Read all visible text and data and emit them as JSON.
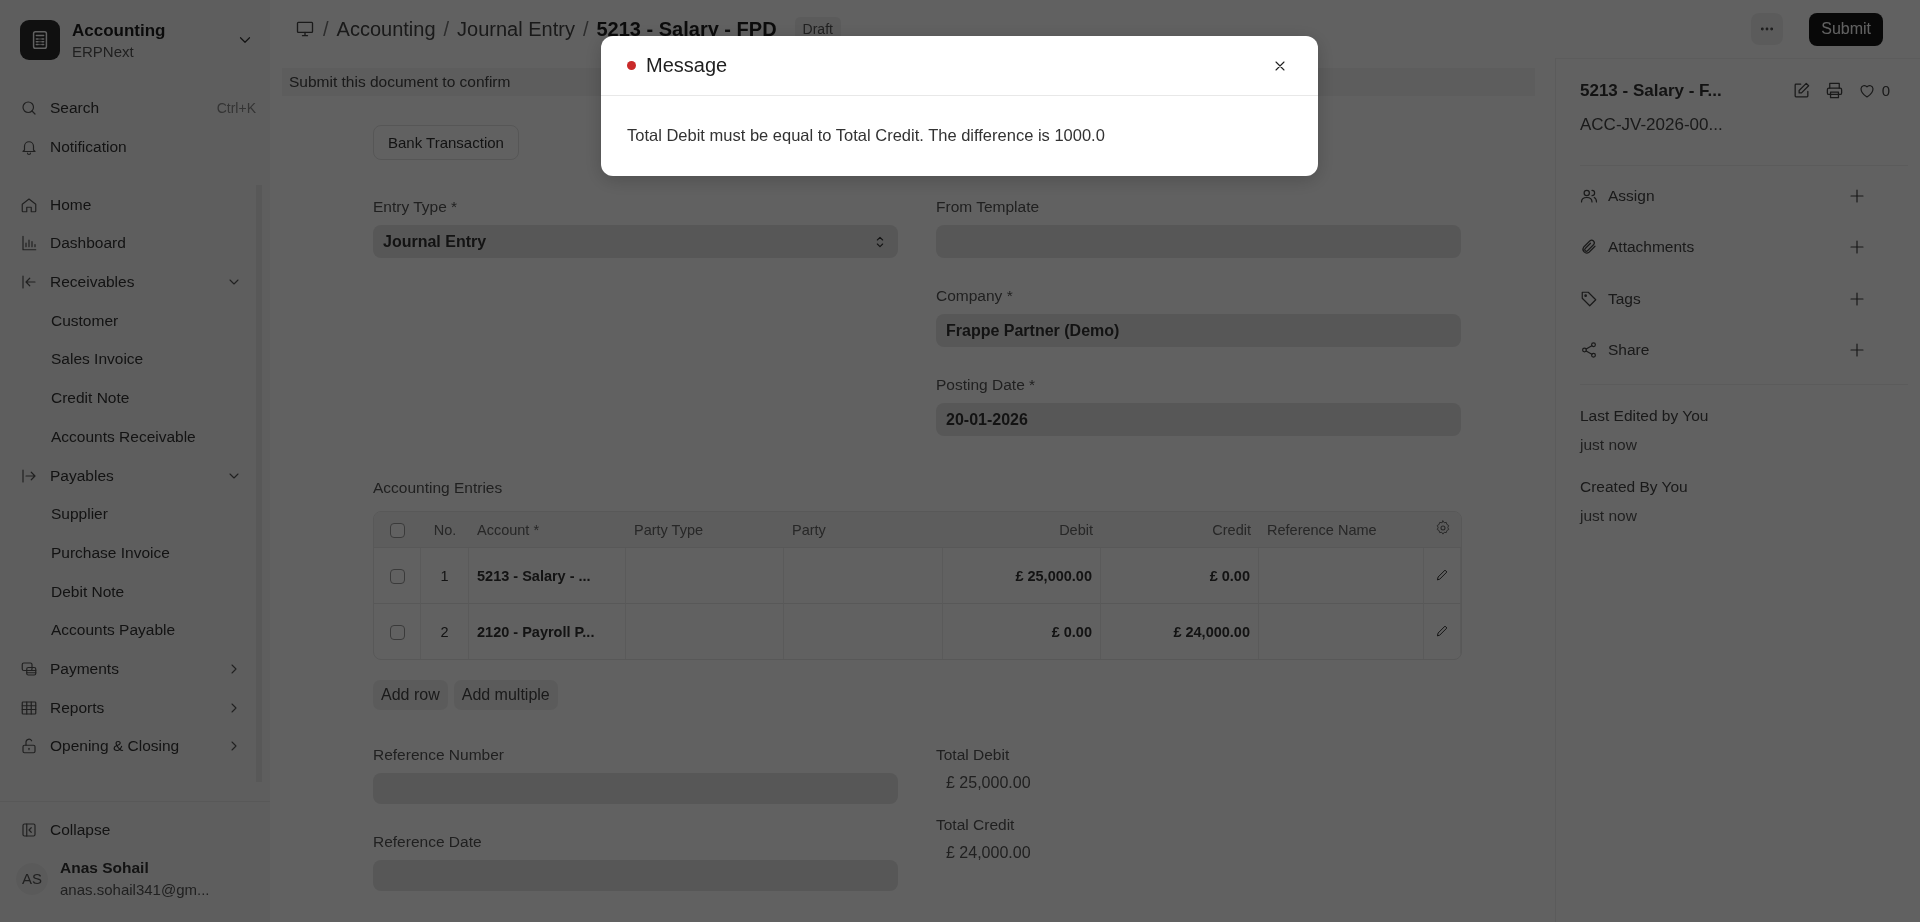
{
  "app": {
    "title": "Accounting",
    "subtitle": "ERPNext"
  },
  "sidebar": {
    "search": {
      "label": "Search",
      "shortcut": "Ctrl+K"
    },
    "notification": "Notification",
    "items": [
      {
        "kind": "link",
        "label": "Home"
      },
      {
        "kind": "link",
        "label": "Dashboard"
      },
      {
        "kind": "group",
        "label": "Receivables",
        "expanded": true,
        "children": [
          {
            "label": "Customer"
          },
          {
            "label": "Sales Invoice"
          },
          {
            "label": "Credit Note"
          },
          {
            "label": "Accounts Receivable"
          }
        ]
      },
      {
        "kind": "group",
        "label": "Payables",
        "expanded": true,
        "children": [
          {
            "label": "Supplier"
          },
          {
            "label": "Purchase Invoice"
          },
          {
            "label": "Debit Note"
          },
          {
            "label": "Accounts Payable"
          }
        ]
      },
      {
        "kind": "group",
        "label": "Payments",
        "expanded": false
      },
      {
        "kind": "group",
        "label": "Reports",
        "expanded": false
      },
      {
        "kind": "group",
        "label": "Opening & Closing",
        "expanded": false
      }
    ],
    "collapse": "Collapse",
    "user": {
      "initials": "AS",
      "name": "Anas Sohail",
      "email": "anas.sohail341@gm..."
    }
  },
  "breadcrumb": [
    {
      "separator": "/",
      "label": "Accounting"
    },
    {
      "separator": "/",
      "label": "Journal Entry"
    },
    {
      "separator": "/",
      "label": "5213 - Salary - FPD"
    }
  ],
  "status_badge": "Draft",
  "primary_button": "Submit",
  "banner": "Submit this document to confirm",
  "form": {
    "bank_transaction_button": "Bank Transaction",
    "left_fields": [
      {
        "kind": "select",
        "label": "Entry Type *",
        "value": "Journal Entry"
      }
    ],
    "right_fields": [
      {
        "kind": "input",
        "label": "From Template"
      },
      {
        "kind": "input",
        "label": "Company *",
        "value": "Frappe Partner (Demo)"
      },
      {
        "kind": "input",
        "label": "Posting Date *",
        "value": "20-01-2026"
      }
    ],
    "table": {
      "title": "Accounting Entries",
      "select_all": {
        "checked": false
      },
      "columns": [
        "No.",
        "Account *",
        "Party Type",
        "Party",
        "Debit",
        "Credit",
        "Reference Name"
      ],
      "rows": [
        {
          "checked": false,
          "no": "1",
          "account": "5213 - Salary - ...",
          "debit": "£ 25,000.00",
          "credit": "£ 0.00"
        },
        {
          "checked": false,
          "no": "2",
          "account": "2120 - Payroll P...",
          "debit": "£ 0.00",
          "credit": "£ 24,000.00"
        }
      ],
      "buttons": [
        "Add row",
        "Add multiple"
      ]
    },
    "lower_left": [
      {
        "label": "Reference Number"
      },
      {
        "label": "Reference Date"
      }
    ],
    "lower_right": [
      {
        "label": "Total Debit",
        "value": "£ 25,000.00"
      },
      {
        "label": "Total Credit",
        "value": "£ 24,000.00"
      }
    ]
  },
  "doc_sidebar": {
    "title": "5213 - Salary - F...",
    "name": "ACC-JV-2026-00...",
    "likes": "0",
    "actions": [
      "Assign",
      "Attachments",
      "Tags",
      "Share"
    ],
    "activity": [
      {
        "label": "Last Edited by You",
        "time": "just now"
      },
      {
        "label": "Created By You",
        "time": "just now"
      }
    ]
  },
  "dialog": {
    "color": "#c92a2a",
    "title": "Message",
    "message": "Total Debit must be equal to Total Credit. The difference is 1000.0"
  }
}
